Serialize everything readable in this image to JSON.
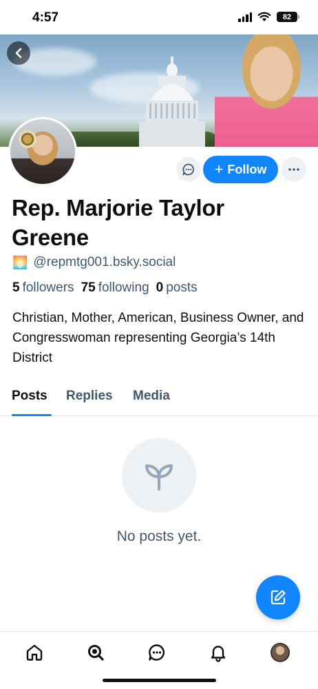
{
  "status_bar": {
    "time": "4:57",
    "battery": "82"
  },
  "profile": {
    "display_name": "Rep. Marjorie Taylor Greene",
    "handle": "@repmtg001.bsky.social",
    "handle_emoji": "🌅",
    "followers_count": "5",
    "followers_label": "followers",
    "following_count": "75",
    "following_label": "following",
    "posts_count": "0",
    "posts_label": "posts",
    "bio": "Christian, Mother, American, Business Owner, and Congresswoman representing Georgia’s 14th District"
  },
  "actions": {
    "follow_label": "Follow",
    "follow_plus": "+"
  },
  "tabs": [
    {
      "label": "Posts",
      "active": true
    },
    {
      "label": "Replies",
      "active": false
    },
    {
      "label": "Media",
      "active": false
    }
  ],
  "empty_state": {
    "text": "No posts yet."
  },
  "colors": {
    "accent": "#1185fe",
    "muted_text": "#42576c",
    "icon_bg": "#eef1f4"
  },
  "icons": {
    "back": "chevron-left-icon",
    "message": "chat-bubble-icon",
    "more": "ellipsis-icon",
    "empty": "seedling-icon",
    "compose": "compose-icon",
    "nav": [
      "home-icon",
      "search-icon",
      "chat-icon",
      "bell-icon",
      "avatar"
    ]
  }
}
